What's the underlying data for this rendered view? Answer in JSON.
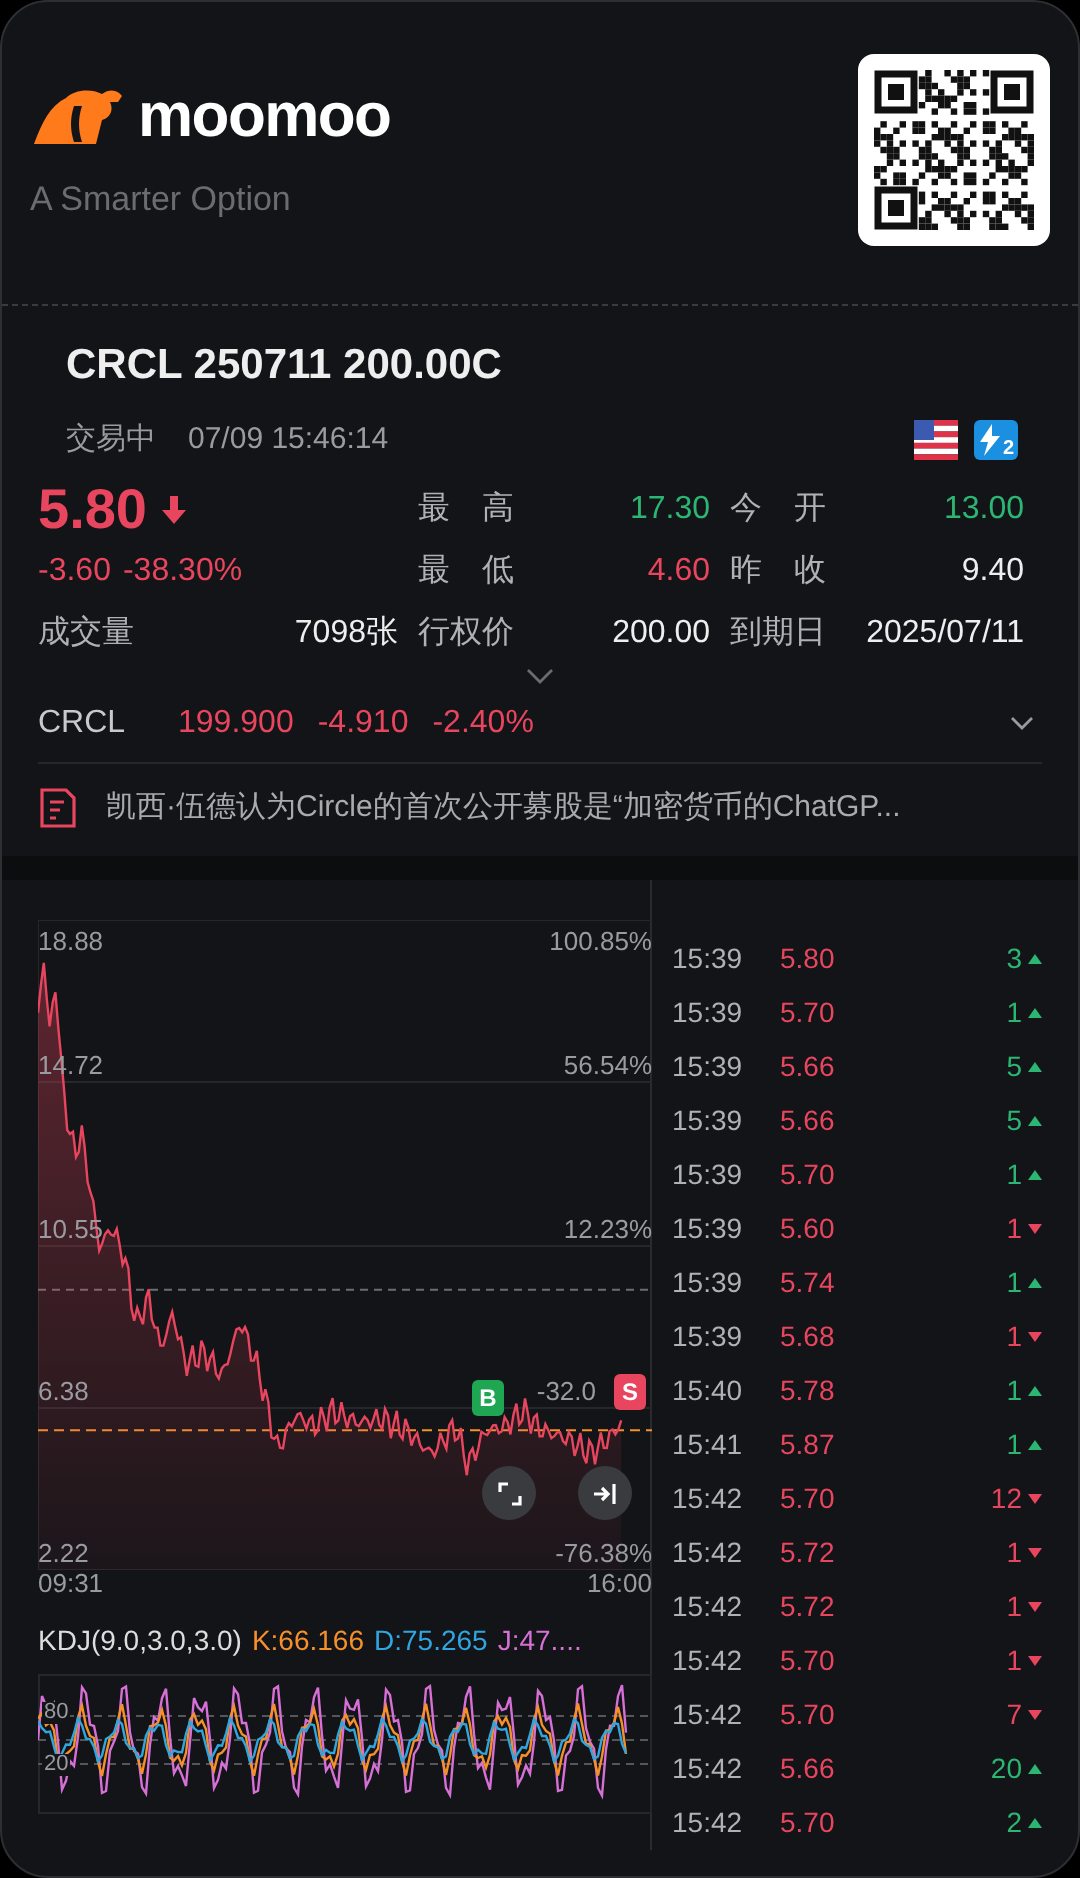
{
  "brand": {
    "name": "moomoo",
    "tagline": "A Smarter Option"
  },
  "option": {
    "title": "CRCL 250711 200.00C",
    "status": "交易中",
    "time": "07/09 15:46:14",
    "badges": [
      {
        "kind": "flag"
      },
      {
        "kind": "level",
        "label": "2"
      }
    ]
  },
  "quote": {
    "price": "5.80",
    "rising": false,
    "change": "-3.60",
    "change_pct": "-38.30%"
  },
  "stats": [
    {
      "label": "最　高",
      "value": "17.30",
      "color": "#2bb673"
    },
    {
      "label": "今　开",
      "value": "13.00",
      "color": "#2bb673"
    },
    {
      "label": "最　低",
      "value": "4.60",
      "color": "#e8455e"
    },
    {
      "label": "昨　收",
      "value": "9.40",
      "color": "#eeeeee"
    },
    {
      "label": "成交量",
      "value": "7098张",
      "color": "#eeeeee"
    },
    {
      "label": "行权价",
      "value": "200.00",
      "color": "#eeeeee"
    },
    {
      "label": "到期日",
      "value": "2025/07/11",
      "color": "#eeeeee"
    }
  ],
  "underlying": {
    "symbol": "CRCL",
    "price": "199.900",
    "change": "-4.910",
    "change_pct": "-2.40%"
  },
  "news": {
    "headline": "凯西·伍德认为Circle的首次公开募股是“加密货币的ChatGP..."
  },
  "price_chart": {
    "left_ticks": [
      "18.88",
      "14.72",
      "10.55",
      "6.38",
      "2.22"
    ],
    "right_ticks": [
      "100.85%",
      "56.54%",
      "12.23%",
      "-32.0",
      "-76.38%"
    ],
    "x_labels": [
      "09:31",
      "16:00"
    ],
    "markers": [
      {
        "label": "B",
        "kind": "buy"
      },
      {
        "label": "S",
        "kind": "sell"
      }
    ]
  },
  "kdj": {
    "title": "KDJ(9.0,3.0,3.0)",
    "values": [
      {
        "text": "K:66.166",
        "color": "#f5902a"
      },
      {
        "text": "D:75.265",
        "color": "#2fa6e0"
      },
      {
        "text": "J:47....",
        "color": "#d66fd6"
      }
    ],
    "ticks": [
      "80",
      "20"
    ]
  },
  "trades": [
    {
      "time": "15:39",
      "price": "5.80",
      "volume": "3",
      "rising": true
    },
    {
      "time": "15:39",
      "price": "5.70",
      "volume": "1",
      "rising": true
    },
    {
      "time": "15:39",
      "price": "5.66",
      "volume": "5",
      "rising": true
    },
    {
      "time": "15:39",
      "price": "5.66",
      "volume": "5",
      "rising": true
    },
    {
      "time": "15:39",
      "price": "5.70",
      "volume": "1",
      "rising": true
    },
    {
      "time": "15:39",
      "price": "5.60",
      "volume": "1",
      "rising": false
    },
    {
      "time": "15:39",
      "price": "5.74",
      "volume": "1",
      "rising": true
    },
    {
      "time": "15:39",
      "price": "5.68",
      "volume": "1",
      "rising": false
    },
    {
      "time": "15:40",
      "price": "5.78",
      "volume": "1",
      "rising": true
    },
    {
      "time": "15:41",
      "price": "5.87",
      "volume": "1",
      "rising": true
    },
    {
      "time": "15:42",
      "price": "5.70",
      "volume": "12",
      "rising": false
    },
    {
      "time": "15:42",
      "price": "5.72",
      "volume": "1",
      "rising": false
    },
    {
      "time": "15:42",
      "price": "5.72",
      "volume": "1",
      "rising": false
    },
    {
      "time": "15:42",
      "price": "5.70",
      "volume": "1",
      "rising": false
    },
    {
      "time": "15:42",
      "price": "5.70",
      "volume": "7",
      "rising": false
    },
    {
      "time": "15:42",
      "price": "5.66",
      "volume": "20",
      "rising": true
    },
    {
      "time": "15:42",
      "price": "5.70",
      "volume": "2",
      "rising": true
    }
  ]
}
